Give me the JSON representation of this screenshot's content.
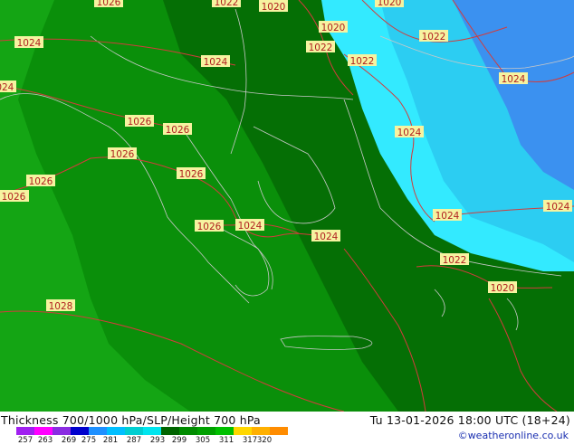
{
  "map": {
    "isobar_labels": [
      "1026",
      "1024",
      "1022",
      "1020",
      "1020",
      "1020",
      "1024",
      "1022",
      "1022",
      "1022",
      "1024",
      "1024",
      "1024",
      "1026",
      "1026",
      "1026",
      "1026",
      "1026",
      "1026",
      "1026",
      "1024",
      "1024",
      "1024",
      "1024",
      "1022",
      "1020",
      "1028",
      "1024",
      "1024",
      "1024"
    ],
    "colors": {
      "green_dark": "#056f05",
      "green_mid": "#0a8f0a",
      "green_light": "#14a514",
      "cyan_light": "#33eaff",
      "cyan_mid": "#2ccdf2",
      "blue": "#3b91f0",
      "isobar": "#d23c3c",
      "coast": "#c8c8c8"
    }
  },
  "footer": {
    "title": "Thickness 700/1000 hPa/SLP/Height 700 hPa",
    "time": "Tu 13-01-2026 18:00 UTC (18+24)",
    "credit": "©weatheronline.co.uk"
  },
  "legend": {
    "ticks": [
      "257",
      "263",
      "269",
      "275",
      "281",
      "287",
      "293",
      "299",
      "305",
      "311",
      "317",
      "320"
    ],
    "colors": [
      "#a020f0",
      "#ff00ff",
      "#8a2be2",
      "#0000cd",
      "#1e90ff",
      "#00bfff",
      "#00ced1",
      "#00e5ee",
      "#006400",
      "#008b00",
      "#00a000",
      "#00c000",
      "#ffd700",
      "#ffb000",
      "#ff8c00"
    ]
  }
}
